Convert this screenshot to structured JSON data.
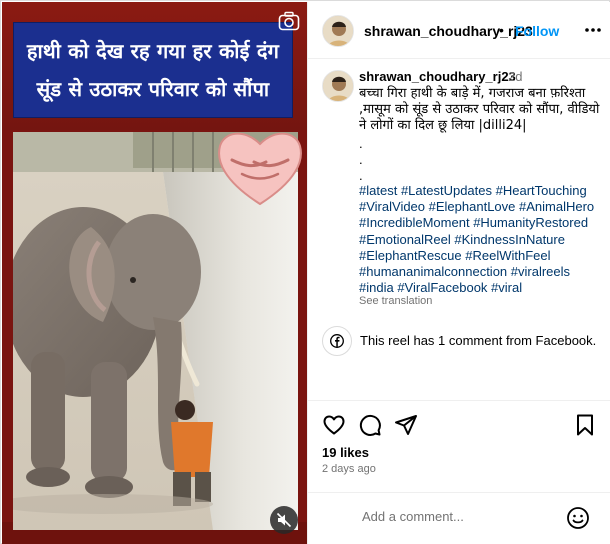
{
  "media": {
    "headline_line1": "हाथी को देख रह गया हर कोई दंग",
    "headline_line2": "सूंड से उठाकर परिवार को सौंपा",
    "camera_icon": "camera-icon",
    "mute_icon": "muted-speaker-icon"
  },
  "header": {
    "username": "shrawan_choudhary_rj23",
    "separator": "•",
    "follow_label": "Follow",
    "more_icon": "more-options-icon"
  },
  "caption": {
    "username": "shrawan_choudhary_rj23",
    "time": "2d",
    "text": "बच्चा गिरा हाथी के बाड़े में, गजराज बना फ़रिश्ता ,मासूम को सूंड से उठाकर परिवार को सौंपा, वीडियो ने लोगों का दिल छू लिया |dilli24|",
    "dots": [
      ".",
      ".",
      "."
    ],
    "hashtags": [
      "#latest",
      "#LatestUpdates",
      "#HeartTouching",
      "#ViralVideo",
      "#ElephantLove",
      "#AnimalHero",
      "#IncredibleMoment",
      "#HumanityRestored",
      "#EmotionalReel",
      "#KindnessInNature",
      "#ElephantRescue",
      "#ReelWithFeel",
      "#humananimalconnection",
      "#viralreels",
      "#india",
      "#ViralFacebook",
      "#viral"
    ],
    "see_translation": "See translation"
  },
  "facebook_note": {
    "icon": "facebook-icon",
    "text": "This reel has 1 comment from Facebook."
  },
  "actions": {
    "like_icon": "heart-icon",
    "comment_icon": "comment-icon",
    "share_icon": "share-icon",
    "save_icon": "bookmark-icon",
    "likes": "19 likes",
    "posted": "2 days ago"
  },
  "comment": {
    "placeholder": "Add a comment...",
    "emoji_icon": "emoji-icon"
  },
  "colors": {
    "link_blue": "#0095f6",
    "hashtag": "#00376b",
    "muted_text": "#737373",
    "headline_bg": "#1b2f8f",
    "media_bg": "#7a1410"
  }
}
